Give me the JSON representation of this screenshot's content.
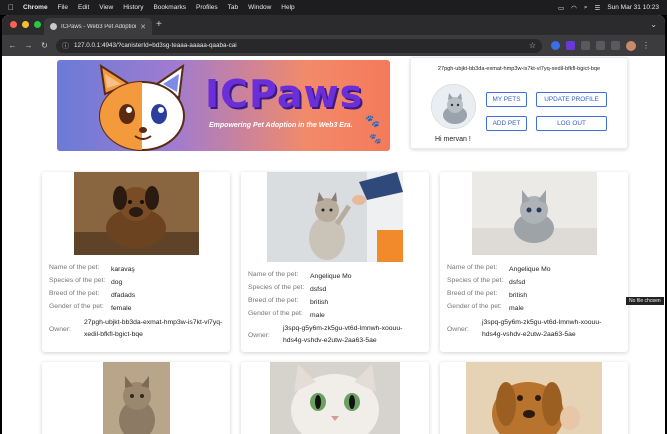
{
  "menubar": {
    "app": "Chrome",
    "items": [
      "File",
      "Edit",
      "View",
      "History",
      "Bookmarks",
      "Profiles",
      "Tab",
      "Window",
      "Help"
    ],
    "clock": "Sun Mar 31  10:23"
  },
  "browser": {
    "tab_title": "ICPaws - Web3 Pet Adoption",
    "url": "127.0.0.1:4943/?canisterId=bd3sg-teaaa-aaaaa-qaaba-cai"
  },
  "banner": {
    "brand": "ICPaws",
    "tagline": "Empowering Pet Adoption in the Web3 Era."
  },
  "profile": {
    "principal": "27pgh-ubjkt-bb3da-exmat-hmp3w-is7kt-vl7yq-xedil-bfkfl-bgict-bqe",
    "greeting": "Hi mervan !",
    "buttons": {
      "my_pets": "MY PETS",
      "update_profile": "UPDATE PROFILE",
      "add_pet": "ADD PET",
      "log_out": "LOG OUT"
    }
  },
  "labels": {
    "name": "Name of the pet:",
    "species": "Species of the pet:",
    "breed": "Breed of the pet:",
    "gender": "Gender of the pet:",
    "owner": "Owner:"
  },
  "pets": [
    {
      "name": "karavaş",
      "species": "dog",
      "breed": "dfadads",
      "gender": "female",
      "owner": "27pgh-ubjkt-bb3da-exmat-hmp3w-is7kt-vl7yq-xedil-bfkfl-bgict-bqe"
    },
    {
      "name": "Angelique Mo",
      "species": "dsfsd",
      "breed": "british",
      "gender": "male",
      "owner": "j3spq-g5y6m-zk5gu-vt6d-lmnwh-xoouu-hds4g-vshdv-e2utw-2aa63-5ae"
    },
    {
      "name": "Angelique Mo",
      "species": "dsfsd",
      "breed": "british",
      "gender": "male",
      "owner": "j3spq-g5y6m-zk5gu-vt6d-lmnwh-xoouu-hds4g-vshdv-e2utw-2aa63-5ae"
    }
  ],
  "tooltip": "No file chosen"
}
